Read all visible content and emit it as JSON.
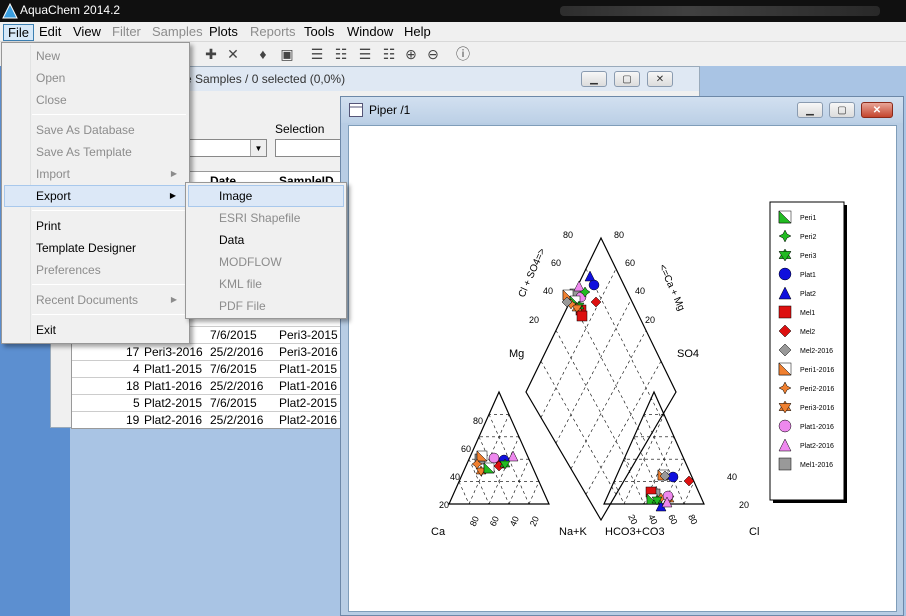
{
  "app": {
    "title": "AquaChem 2014.2"
  },
  "menubar": {
    "items": [
      "File",
      "Edit",
      "View",
      "Filter",
      "Samples",
      "Plots",
      "Reports",
      "Tools",
      "Window",
      "Help"
    ]
  },
  "samples_window": {
    "title": "e Samples / 0 selected (0,0%)",
    "selection_label": "Selection",
    "columns": [
      "Date",
      "SampleID"
    ],
    "rows": [
      {
        "num": "",
        "name": "",
        "date": "7/6/2015",
        "id": "Peri3-2015"
      },
      {
        "num": "17",
        "name": "Peri3-2016",
        "date": "25/2/2016",
        "id": "Peri3-2016"
      },
      {
        "num": "4",
        "name": "Plat1-2015",
        "date": "7/6/2015",
        "id": "Plat1-2015"
      },
      {
        "num": "18",
        "name": "Plat1-2016",
        "date": "25/2/2016",
        "id": "Plat1-2016"
      },
      {
        "num": "5",
        "name": "Plat2-2015",
        "date": "7/6/2015",
        "id": "Plat2-2015"
      },
      {
        "num": "19",
        "name": "Plat2-2016",
        "date": "25/2/2016",
        "id": "Plat2-2016"
      }
    ]
  },
  "file_menu": {
    "items": [
      {
        "label": "New",
        "disabled": true
      },
      {
        "label": "Open",
        "disabled": true
      },
      {
        "label": "Close",
        "disabled": true
      },
      {
        "label": "Save As Database",
        "disabled": true
      },
      {
        "label": "Save As Template",
        "disabled": true
      },
      {
        "label": "Import",
        "disabled": true
      },
      {
        "label": "Export",
        "disabled": false
      },
      {
        "label": "Print",
        "disabled": false
      },
      {
        "label": "Template Designer",
        "disabled": false
      },
      {
        "label": "Preferences",
        "disabled": true
      },
      {
        "label": "Recent Documents",
        "disabled": true
      },
      {
        "label": "Exit",
        "disabled": false
      }
    ]
  },
  "export_submenu": {
    "items": [
      {
        "label": "Image",
        "disabled": false
      },
      {
        "label": "ESRI Shapefile",
        "disabled": true
      },
      {
        "label": "Data",
        "disabled": false
      },
      {
        "label": "MODFLOW",
        "disabled": true
      },
      {
        "label": "KML file",
        "disabled": true
      },
      {
        "label": "PDF File",
        "disabled": true
      }
    ]
  },
  "piper_window": {
    "title": "Piper /1",
    "labels": {
      "mg": "Mg",
      "so4": "SO4",
      "ca": "Ca",
      "nak": "Na+K",
      "hco3": "HCO3+CO3",
      "cl": "Cl",
      "clso4": "Cl + SO4=>",
      "camg": "<=Ca + Mg"
    },
    "ticks": [
      "20",
      "40",
      "60",
      "80"
    ],
    "legend": [
      {
        "name": "Peri1",
        "color": "#22bb22",
        "shape": "half-square"
      },
      {
        "name": "Peri2",
        "color": "#22bb22",
        "shape": "star"
      },
      {
        "name": "Peri3",
        "color": "#22bb22",
        "shape": "hexstar"
      },
      {
        "name": "Plat1",
        "color": "#1010dd",
        "shape": "circle"
      },
      {
        "name": "Plat2",
        "color": "#1010dd",
        "shape": "triangle"
      },
      {
        "name": "Mel1",
        "color": "#dd1010",
        "shape": "square"
      },
      {
        "name": "Mel2",
        "color": "#dd1010",
        "shape": "diamond"
      },
      {
        "name": "Mel2-2016",
        "color": "#999999",
        "shape": "diamond"
      },
      {
        "name": "Peri1-2016",
        "color": "#f08030",
        "shape": "half-square"
      },
      {
        "name": "Peri2-2016",
        "color": "#f08030",
        "shape": "star"
      },
      {
        "name": "Peri3-2016",
        "color": "#f08030",
        "shape": "hexstar"
      },
      {
        "name": "Plat1-2016",
        "color": "#ee88ee",
        "shape": "circle"
      },
      {
        "name": "Plat2-2016",
        "color": "#ee88ee",
        "shape": "triangle"
      },
      {
        "name": "Mel1-2016",
        "color": "#999999",
        "shape": "square"
      }
    ]
  }
}
